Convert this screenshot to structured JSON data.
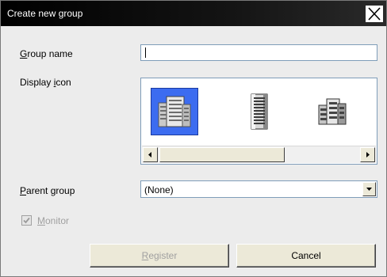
{
  "window": {
    "title": "Create new group"
  },
  "form": {
    "group_name": {
      "label_accel": "G",
      "label_rest": "roup name",
      "value": ""
    },
    "display_icon": {
      "label_pre": "Display ",
      "label_accel": "i",
      "label_rest": "con",
      "icons": [
        "building-blue-icon",
        "tower-building-icon",
        "office-building-icon"
      ],
      "selected_index": 0
    },
    "parent_group": {
      "label_accel": "P",
      "label_rest": "arent group",
      "value": "(None)"
    },
    "monitor": {
      "label_accel": "M",
      "label_rest": "onitor",
      "checked": true,
      "enabled": false
    }
  },
  "buttons": {
    "register_accel": "R",
    "register_rest": "egister",
    "cancel": "Cancel"
  }
}
